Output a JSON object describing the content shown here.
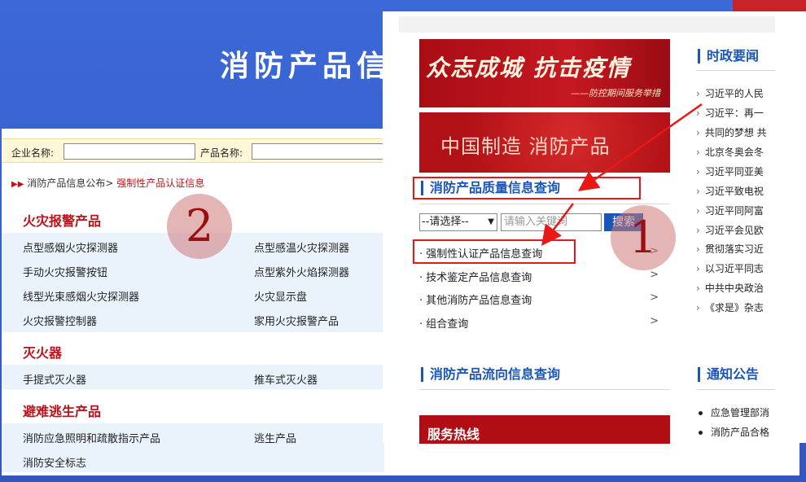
{
  "background_page": {
    "title": "消防产品信",
    "search": {
      "enterprise_label": "企业名称:",
      "product_label": "产品名称:"
    },
    "breadcrumb": {
      "parent": "消防产品信息公布>",
      "current": "强制性产品认证信息"
    },
    "categories": [
      {
        "title": "火灾报警产品",
        "items": [
          "点型感烟火灾探测器",
          "点型感温火灾探测器",
          "手动火灾报警按钮",
          "点型紫外火焰探测器",
          "线型光束感烟火灾探测器",
          "火灾显示盘",
          "火灾报警控制器",
          "家用火灾报警产品"
        ]
      },
      {
        "title": "灭火器",
        "items": [
          "手提式灭火器",
          "推车式灭火器"
        ]
      },
      {
        "title": "避难逃生产品",
        "items": [
          "消防应急照明和疏散指示产品",
          "逃生产品",
          "消防安全标志"
        ]
      }
    ],
    "step_marker": "2"
  },
  "overlay": {
    "banner1": {
      "text": "众志成城  抗击疫情",
      "sub": "——防控期间服务举措"
    },
    "banner2": {
      "text": "中国制造  消防产品"
    },
    "query_section": {
      "title": "消防产品质量信息查询",
      "select_value": "--请选择--",
      "keyword_placeholder": "请输入关键词",
      "search_button": "搜索",
      "links": [
        {
          "label": "· 强制性认证产品信息查询",
          "arrow": ">"
        },
        {
          "label": "· 技术鉴定产品信息查询",
          "arrow": ">"
        },
        {
          "label": "· 其他消防产品信息查询",
          "arrow": ">"
        },
        {
          "label": "· 组合查询",
          "arrow": ">"
        }
      ]
    },
    "flow_section": {
      "title": "消防产品流向信息查询"
    },
    "hotline": {
      "title": "服务热线"
    },
    "news": {
      "title": "时政要闻",
      "items": [
        "习近平的人民",
        "习近平：再一",
        "共同的梦想 共",
        "北京冬奥会冬",
        "习近平同亚美",
        "习近平致电祝",
        "习近平同阿富",
        "习近平会见欧",
        "贯彻落实习近",
        "以习近平同志",
        "中共中央政治",
        "《求是》杂志"
      ]
    },
    "notice": {
      "title": "通知公告",
      "items": [
        "应急管理部消",
        "消防产品合格"
      ]
    },
    "step_marker": "1"
  },
  "colors": {
    "accent_blue": "#1a55b8",
    "brand_red": "#c0101a",
    "highlight_red": "#e81818",
    "banner_red": "#b00d14"
  }
}
